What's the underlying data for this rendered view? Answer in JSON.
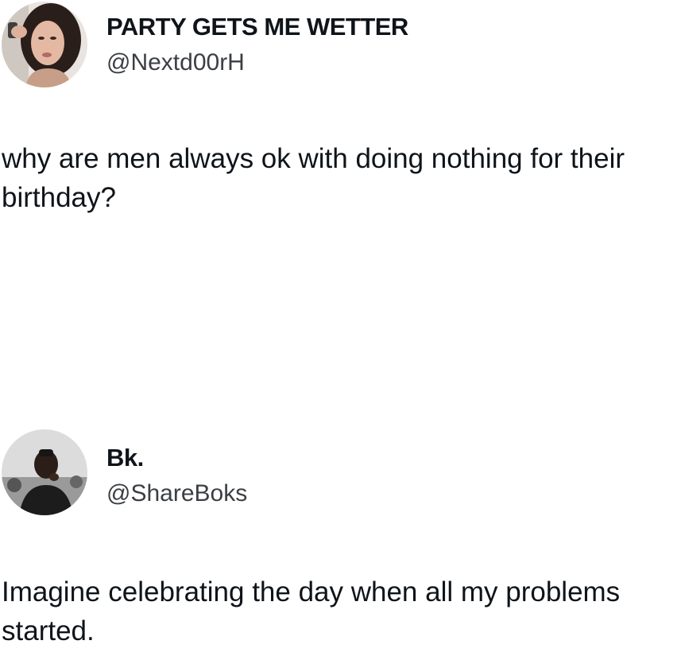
{
  "tweets": [
    {
      "display_name": "PARTY GETS ME WETTER",
      "handle": "@Nextd00rH",
      "text": "why are men always ok with doing nothing for their birthday?",
      "avatar_icon": "profile-photo-woman"
    },
    {
      "display_name": "Bk.",
      "handle": "@ShareBoks",
      "text": "Imagine celebrating the day when all my problems started.",
      "avatar_icon": "profile-photo-man"
    }
  ],
  "colors": {
    "background": "#ffffff",
    "text": "#0f1419",
    "handle": "#3b3f44"
  }
}
